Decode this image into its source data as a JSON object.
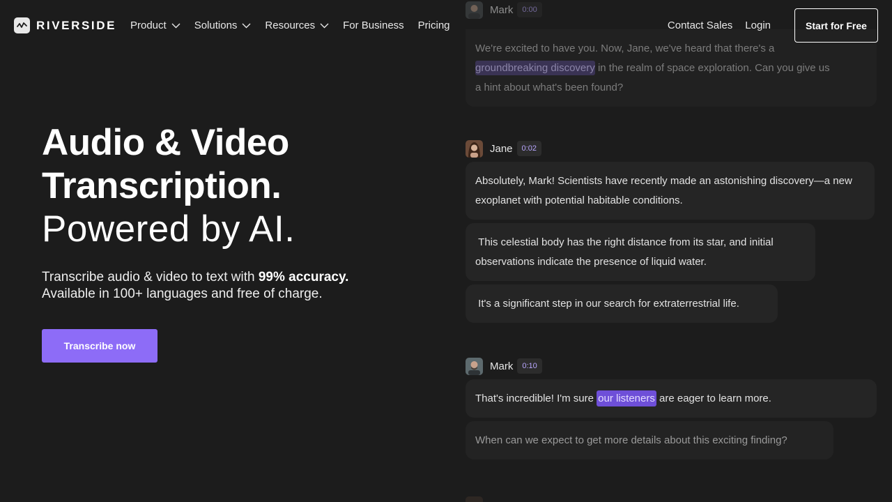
{
  "brand": {
    "name": "RIVERSIDE"
  },
  "nav": {
    "items": [
      {
        "label": "Product",
        "dropdown": true
      },
      {
        "label": "Solutions",
        "dropdown": true
      },
      {
        "label": "Resources",
        "dropdown": true
      },
      {
        "label": "For Business",
        "dropdown": false
      },
      {
        "label": "Pricing",
        "dropdown": false
      }
    ],
    "contact_sales": "Contact Sales",
    "login": "Login",
    "start_free": "Start for Free"
  },
  "hero": {
    "title_line1": "Audio & Video",
    "title_line2": "Transcription.",
    "title_line3": "Powered by AI.",
    "sub_prefix": "Transcribe audio & video to text with ",
    "sub_bold": "99% accuracy.",
    "sub_line2": "Available in 100+ languages and free of charge.",
    "cta": "Transcribe now"
  },
  "transcript": {
    "groups": [
      {
        "speaker": "Mark",
        "time": "0:00",
        "intro_a": "We're excited to have you. Now, Jane, we've heard that there's a",
        "highlight": "groundbreaking discovery",
        "intro_b": " in the realm of space exploration. Can you give us",
        "intro_c": "a hint about what's been found?"
      },
      {
        "speaker": "Jane",
        "time": "0:02",
        "lines": [
          "Absolutely, Mark! Scientists have recently made an astonishing discovery—a new exoplanet with potential habitable conditions.",
          " This celestial body has the right distance from its star, and initial observations indicate the presence of liquid water.",
          " It's a significant step in our search for extraterrestrial life."
        ]
      },
      {
        "speaker": "Mark",
        "time": "0:10",
        "line1_a": "That's incredible! I'm sure ",
        "highlight": "our listeners",
        "line1_b": " are eager to learn more.",
        "line2": "When can we expect to get more details about this exciting finding?"
      }
    ]
  },
  "colors": {
    "accent": "#8d6cf7",
    "background": "#1c1c1c",
    "highlight": "#6e4fd8"
  }
}
